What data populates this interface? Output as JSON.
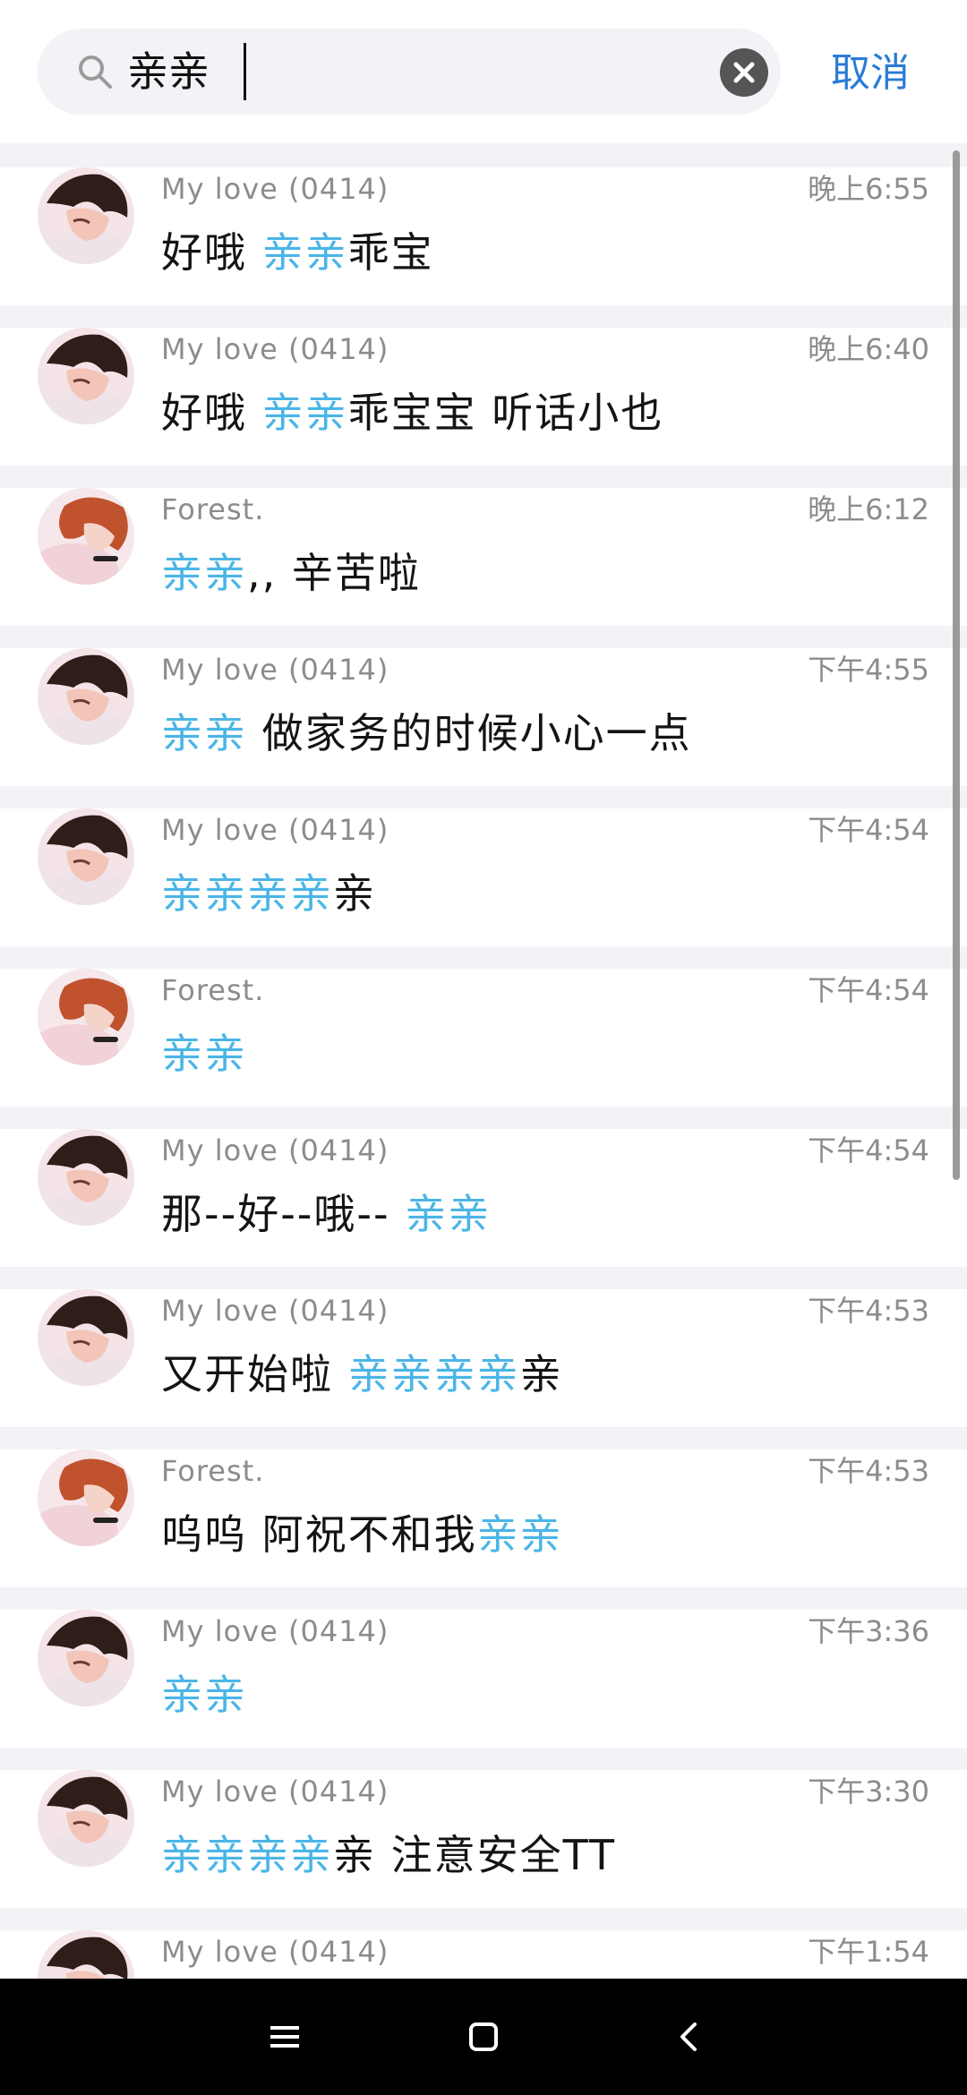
{
  "search": {
    "query": "亲亲",
    "cancel_label": "取消",
    "icon": "search-icon",
    "clear_icon": "clear-icon"
  },
  "colors": {
    "highlight": "#4ab5e6",
    "cancel": "#2b7bd6",
    "meta_text": "#8c8c8c",
    "body_text": "#141414",
    "background": "#f2f3f6"
  },
  "results": [
    {
      "sender": "My love (0414)",
      "time": "晚上6:55",
      "avatar": "avatar-dark-hair",
      "message": [
        {
          "text": "好哦 ",
          "hl": false
        },
        {
          "text": "亲亲",
          "hl": true
        },
        {
          "text": "乖宝",
          "hl": false
        }
      ]
    },
    {
      "sender": "My love (0414)",
      "time": "晚上6:40",
      "avatar": "avatar-dark-hair",
      "message": [
        {
          "text": "好哦 ",
          "hl": false
        },
        {
          "text": "亲亲",
          "hl": true
        },
        {
          "text": "乖宝宝 听话小也",
          "hl": false
        }
      ]
    },
    {
      "sender": "Forest.",
      "time": "晚上6:12",
      "avatar": "avatar-red-hair",
      "message": [
        {
          "text": "亲亲",
          "hl": true
        },
        {
          "text": ",, 辛苦啦",
          "hl": false
        }
      ]
    },
    {
      "sender": "My love (0414)",
      "time": "下午4:55",
      "avatar": "avatar-dark-hair",
      "message": [
        {
          "text": "亲亲",
          "hl": true
        },
        {
          "text": " 做家务的时候小心一点",
          "hl": false
        }
      ]
    },
    {
      "sender": "My love (0414)",
      "time": "下午4:54",
      "avatar": "avatar-dark-hair",
      "message": [
        {
          "text": "亲亲亲亲",
          "hl": true
        },
        {
          "text": "亲",
          "hl": false
        }
      ]
    },
    {
      "sender": "Forest.",
      "time": "下午4:54",
      "avatar": "avatar-red-hair",
      "message": [
        {
          "text": "亲亲",
          "hl": true
        }
      ]
    },
    {
      "sender": "My love (0414)",
      "time": "下午4:54",
      "avatar": "avatar-dark-hair",
      "message": [
        {
          "text": "那--好--哦-- ",
          "hl": false
        },
        {
          "text": "亲亲",
          "hl": true
        }
      ]
    },
    {
      "sender": "My love (0414)",
      "time": "下午4:53",
      "avatar": "avatar-dark-hair",
      "message": [
        {
          "text": "又开始啦 ",
          "hl": false
        },
        {
          "text": "亲亲亲亲",
          "hl": true
        },
        {
          "text": "亲",
          "hl": false
        }
      ]
    },
    {
      "sender": "Forest.",
      "time": "下午4:53",
      "avatar": "avatar-red-hair",
      "message": [
        {
          "text": "呜呜 阿祝不和我",
          "hl": false
        },
        {
          "text": "亲亲",
          "hl": true
        }
      ]
    },
    {
      "sender": "My love (0414)",
      "time": "下午3:36",
      "avatar": "avatar-dark-hair",
      "message": [
        {
          "text": "亲亲",
          "hl": true
        }
      ]
    },
    {
      "sender": "My love (0414)",
      "time": "下午3:30",
      "avatar": "avatar-dark-hair",
      "message": [
        {
          "text": "亲亲亲亲",
          "hl": true
        },
        {
          "text": "亲 注意安全TT",
          "hl": false
        }
      ]
    },
    {
      "sender": "My love (0414)",
      "time": "下午1:54",
      "avatar": "avatar-dark-hair",
      "message": []
    }
  ],
  "navbar": {
    "menu_icon": "menu-icon",
    "home_icon": "home-icon",
    "back_icon": "back-icon"
  }
}
